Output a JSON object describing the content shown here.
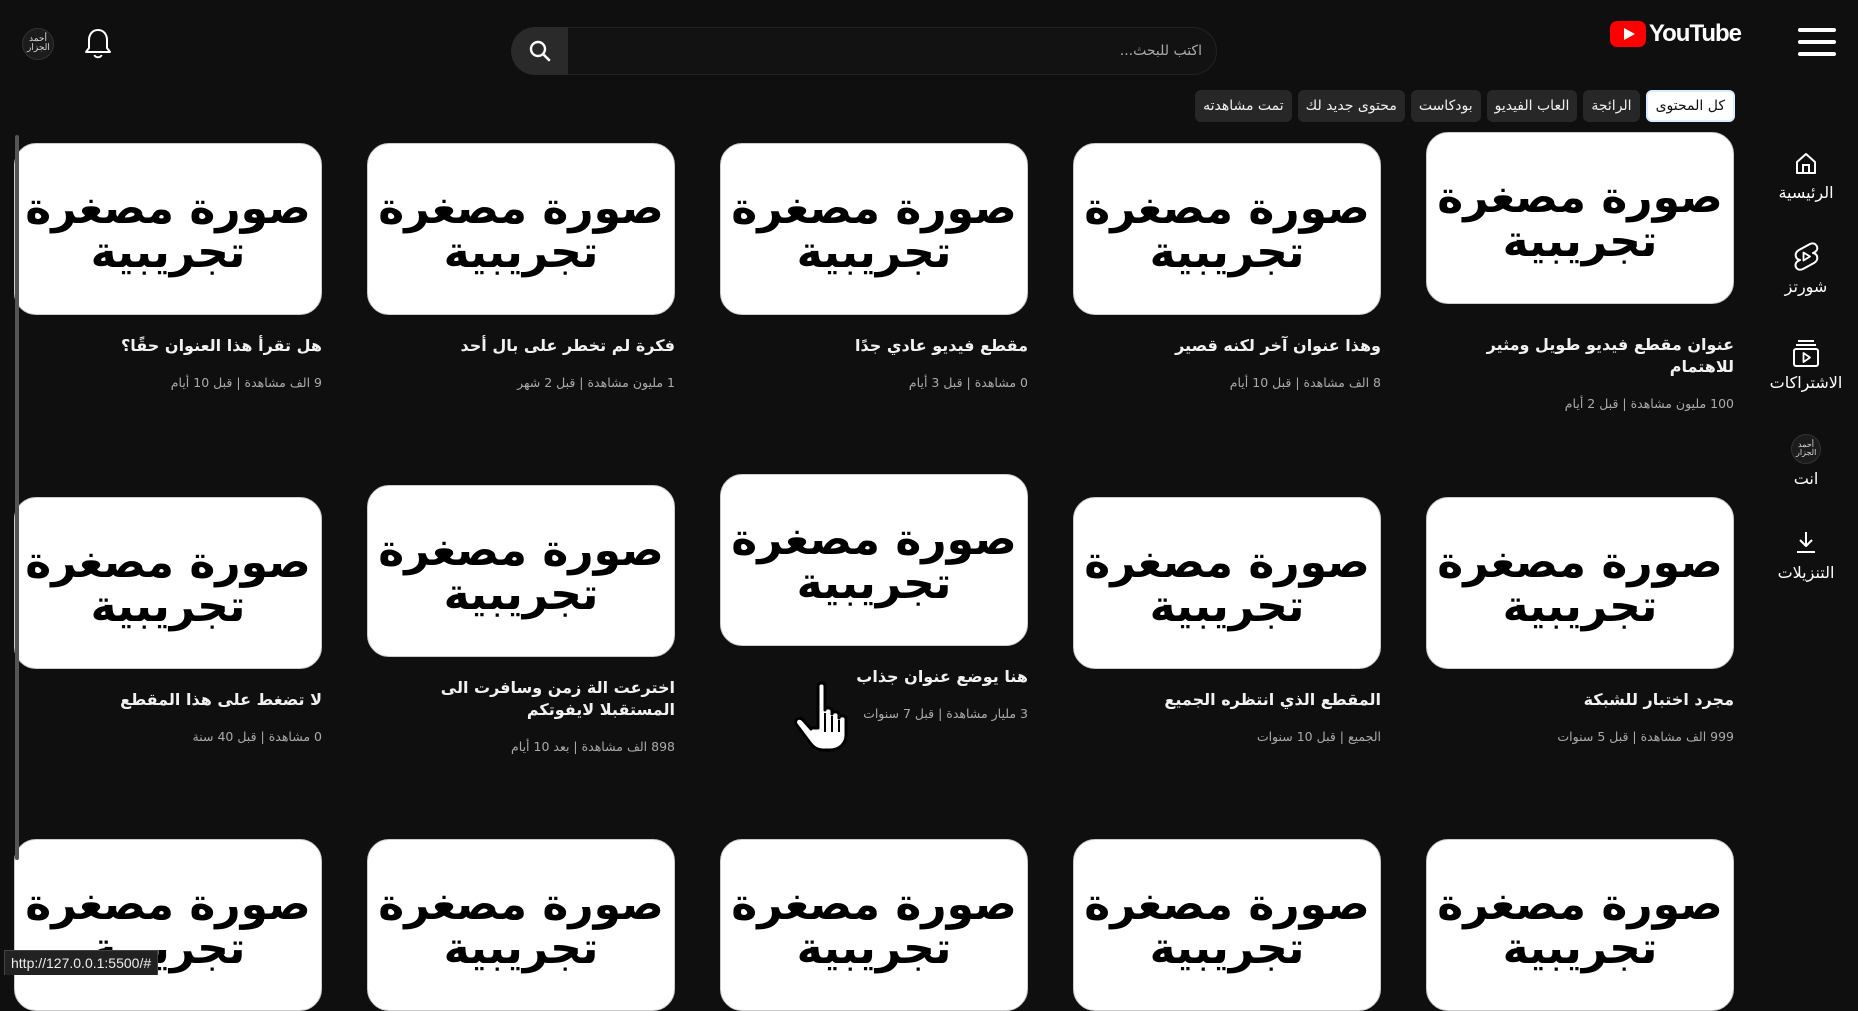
{
  "header": {
    "logo_text": "YouTube",
    "search_placeholder": "اكتب للبحث...",
    "avatar_text": "أحمد الجزار"
  },
  "chips": [
    "كل المحتوى",
    "الرائجة",
    "العاب الفيديو",
    "بودكاست",
    "محتوى جديد لك",
    "تمت مشاهدته"
  ],
  "active_chip": "كل المحتوى",
  "sidebar": {
    "items": [
      {
        "label": "الرئيسية",
        "icon": "home-icon"
      },
      {
        "label": "شورتز",
        "icon": "shorts-icon"
      },
      {
        "label": "الاشتراكات",
        "icon": "subscriptions-icon"
      },
      {
        "label": "انت",
        "icon": "avatar"
      },
      {
        "label": "التنزيلات",
        "icon": "download-icon"
      }
    ]
  },
  "thumbnail_text": "صورة مصغرة تجريبية",
  "videos": [
    {
      "title": "عنوان مقطع فيديو طويل ومثير للاهتمام",
      "meta": "100 مليون مشاهدة | قبل 2 أيام"
    },
    {
      "title": "وهذا عنوان آخر لكنه قصير",
      "meta": "8 الف مشاهدة | قبل 10 أيام"
    },
    {
      "title": "مقطع فيديو عادي جدًا",
      "meta": "0 مشاهدة | قبل 3 أيام"
    },
    {
      "title": "فكرة لم تخطر على بال أحد",
      "meta": "1 مليون مشاهدة | قبل 2 شهر"
    },
    {
      "title": "هل تقرأ هذا العنوان حقًا؟",
      "meta": "9 الف مشاهدة | قبل 10 أيام"
    },
    {
      "title": "مجرد اختبار للشبكة",
      "meta": "999 الف مشاهدة | قبل 5 سنوات"
    },
    {
      "title": "المقطع الذي انتظره الجميع",
      "meta": "الجميع | قبل 10 سنوات"
    },
    {
      "title": "هنا يوضع عنوان جذاب",
      "meta": "3 مليار مشاهدة | قبل 7 سنوات"
    },
    {
      "title": "اخترعت الة زمن وسافرت الى المستقبلا لايفوتكم",
      "meta": "898 الف مشاهدة | بعد 10 أيام"
    },
    {
      "title": "لا تضغط على هذا المقطع",
      "meta": "0 مشاهدة | قبل 40 سنة"
    }
  ],
  "status_url": "http://127.0.0.1:5500/#"
}
